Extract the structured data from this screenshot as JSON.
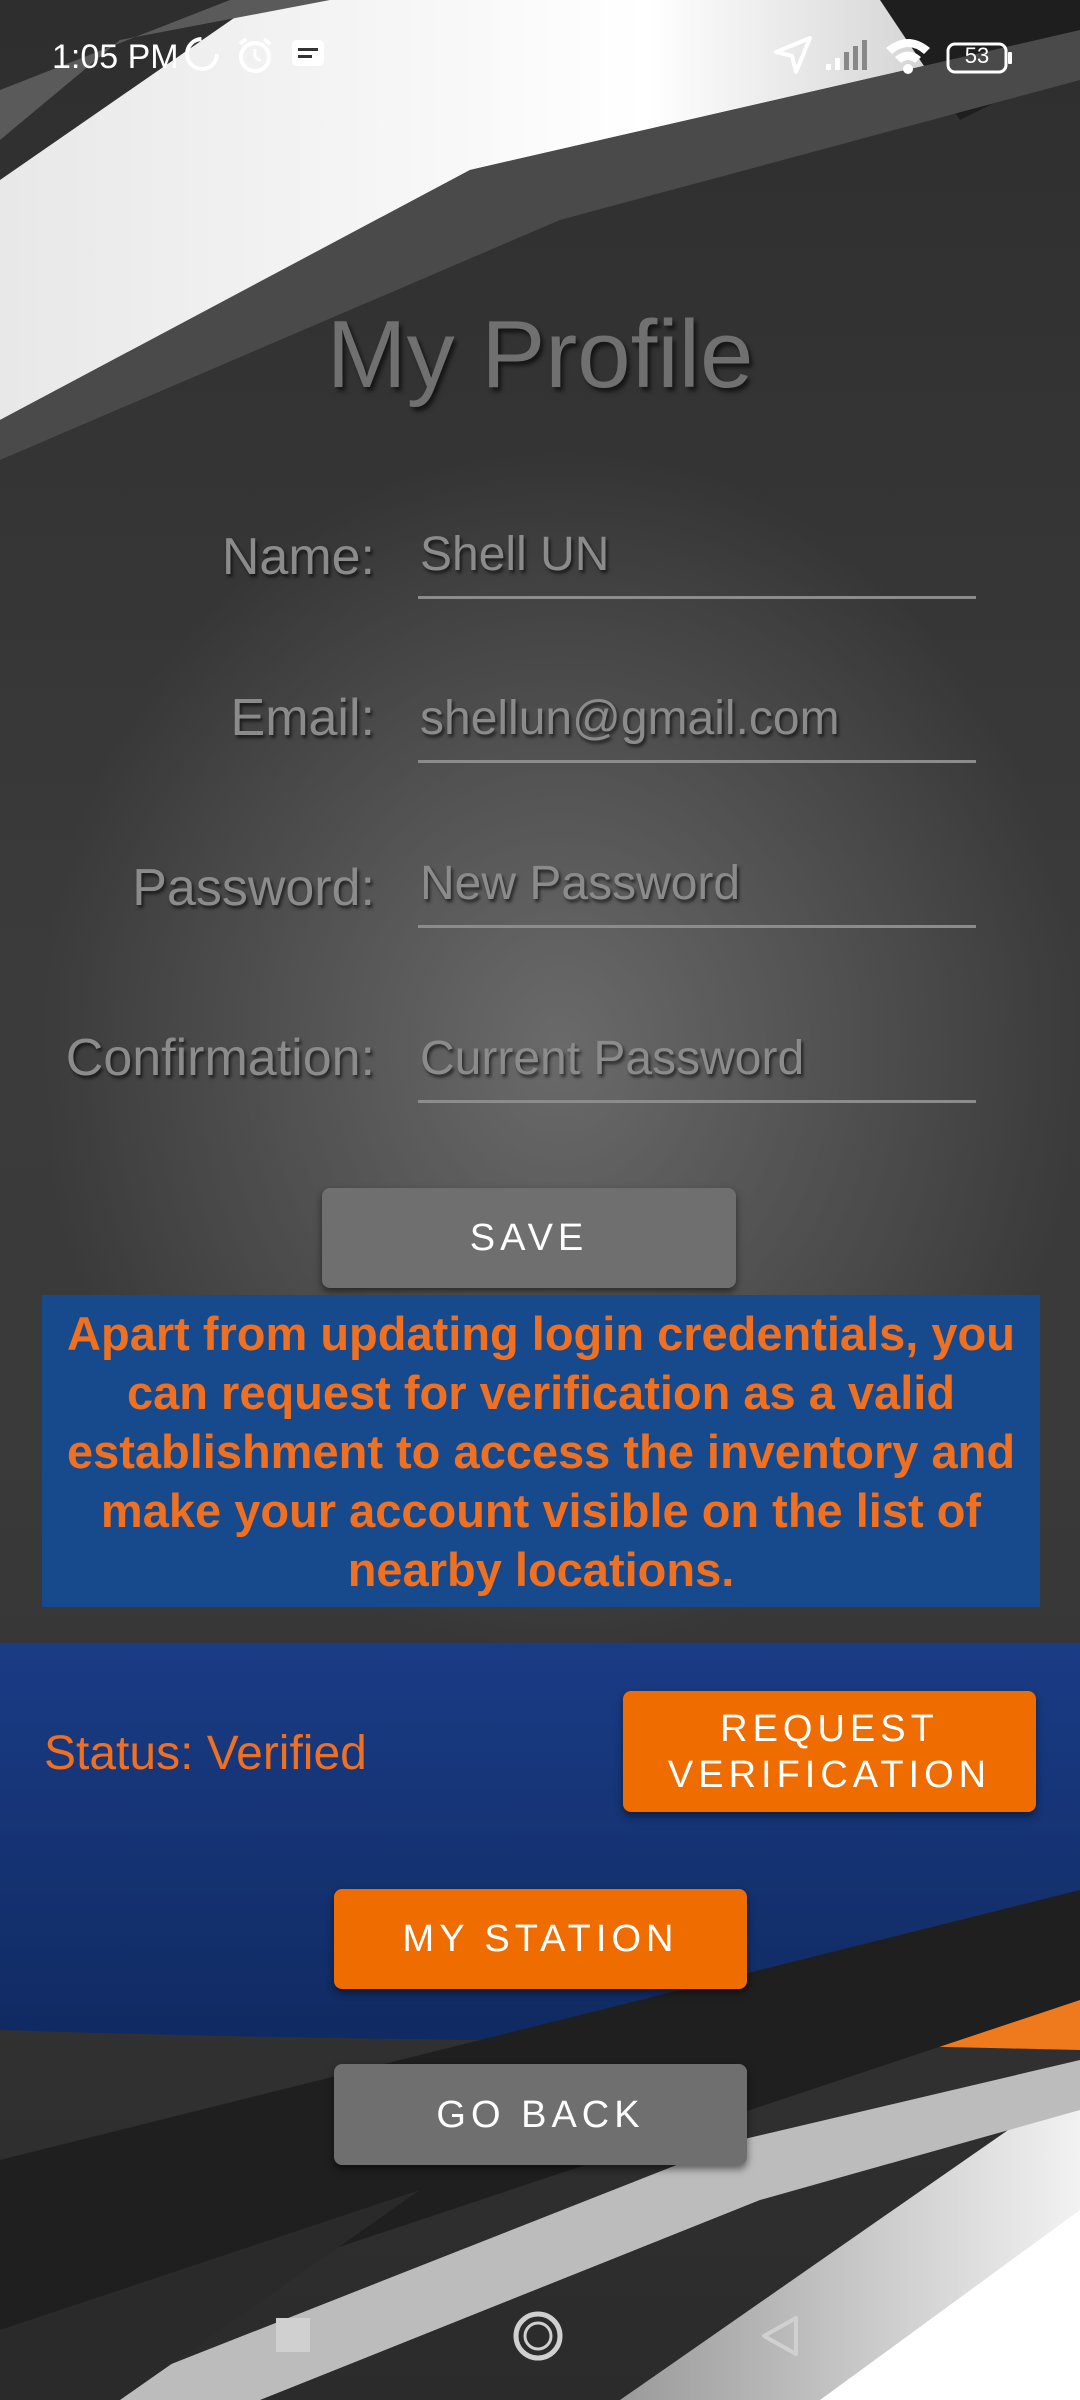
{
  "status_bar": {
    "time": "1:05 PM",
    "battery": "53",
    "icons": [
      "data-saver-icon",
      "alarm-icon",
      "message-icon",
      "location-arrow-icon",
      "signal-icon",
      "wifi-icon",
      "battery-icon"
    ]
  },
  "page": {
    "title": "My Profile"
  },
  "form": {
    "name_label": "Name:",
    "name_value": "Shell UN",
    "email_label": "Email:",
    "email_value": "shellun@gmail.com",
    "password_label": "Password:",
    "password_placeholder": "New Password",
    "confirmation_label": "Confirmation:",
    "confirmation_placeholder": "Current Password"
  },
  "buttons": {
    "save": "SAVE",
    "request_line1": "REQUEST",
    "request_line2": "VERIFICATION",
    "my_station": "MY STATION",
    "go_back": "GO BACK"
  },
  "info": {
    "text": "Apart from updating login credentials, you can request for verification as a valid establishment to access the inventory and make your account visible on the list of nearby locations."
  },
  "verification": {
    "status": "Status: Verified"
  },
  "colors": {
    "accent": "#ef6c00",
    "info_bg": "#174a8c",
    "band_bg": "#14306e",
    "button_gray": "#6f6f6f"
  },
  "navigation": {
    "icons": [
      "recents-square-icon",
      "home-circle-icon",
      "back-triangle-icon"
    ]
  }
}
